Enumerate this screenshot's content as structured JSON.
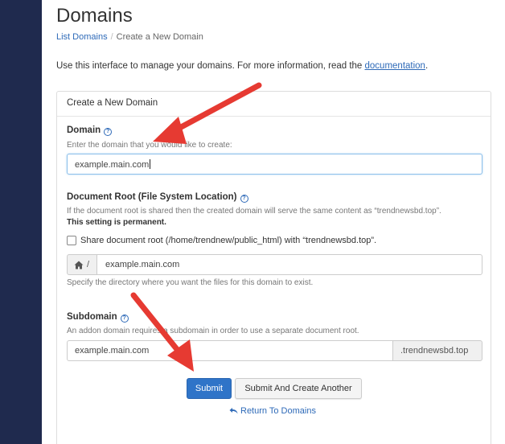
{
  "page": {
    "title": "Domains"
  },
  "breadcrumb": {
    "link": "List Domains",
    "separator": "/",
    "current": "Create a New Domain"
  },
  "intro": {
    "text": "Use this interface to manage your domains. For more information, read the ",
    "link": "documentation",
    "suffix": "."
  },
  "panel": {
    "heading": "Create a New Domain"
  },
  "domain": {
    "label": "Domain",
    "hint": "Enter the domain that you would like to create:",
    "value": "example.main.com"
  },
  "docroot": {
    "label": "Document Root (File System Location)",
    "hint": "If the document root is shared then the created domain will serve the same content as “trendnewsbd.top”.",
    "warning": "This setting is permanent.",
    "share_label": "Share document root (/home/trendnew/public_html) with “trendnewsbd.top”.",
    "prefix": "/",
    "value": "example.main.com",
    "help": "Specify the directory where you want the files for this domain to exist."
  },
  "subdomain": {
    "label": "Subdomain",
    "hint": "An addon domain requires a subdomain in order to use a separate document root.",
    "value": "example.main.com",
    "suffix": ".trendnewsbd.top"
  },
  "actions": {
    "submit": "Submit",
    "submit_another": "Submit And Create Another",
    "return": "Return To Domains"
  },
  "icons": {
    "help": "help-circle-icon",
    "home": "home-icon",
    "return": "return-arrow-icon",
    "annotation": "red-arrow-icon"
  },
  "colors": {
    "sidebar": "#1f2a4e",
    "link": "#2e6ab8",
    "primary": "#2f74c8",
    "annotation": "#e63a32"
  }
}
